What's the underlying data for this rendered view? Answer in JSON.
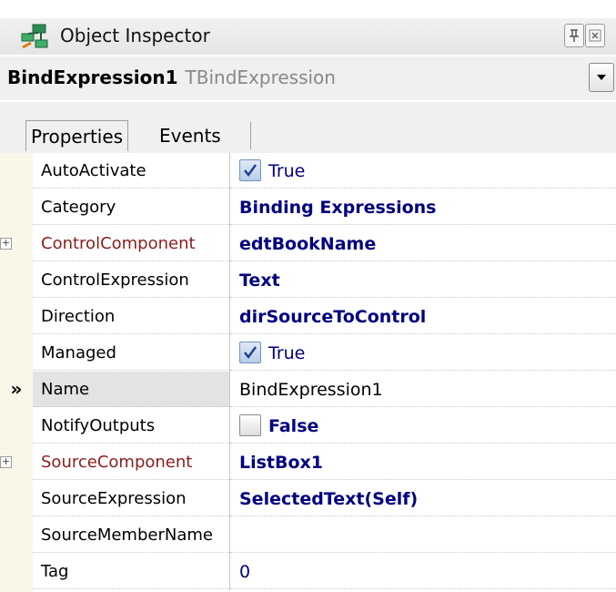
{
  "window": {
    "title": "Object Inspector",
    "pin_icon": "pin-icon",
    "close_icon": "close-icon"
  },
  "component_selector": {
    "name": "BindExpression1",
    "type": "TBindExpression"
  },
  "tabs": [
    {
      "label": "Properties",
      "active": true
    },
    {
      "label": "Events",
      "active": false
    }
  ],
  "properties": [
    {
      "name": "AutoActivate",
      "value": "True",
      "checkbox": true,
      "checked": true
    },
    {
      "name": "Category",
      "value": "Binding Expressions",
      "bold": true
    },
    {
      "name": "ControlComponent",
      "value": "edtBookName",
      "bold": true,
      "expandable": true,
      "red": true
    },
    {
      "name": "ControlExpression",
      "value": "Text",
      "bold": true
    },
    {
      "name": "Direction",
      "value": "dirSourceToControl",
      "bold": true
    },
    {
      "name": "Managed",
      "value": "True",
      "checkbox": true,
      "checked": true
    },
    {
      "name": "Name",
      "value": "BindExpression1",
      "selected": true,
      "indicator": "»"
    },
    {
      "name": "NotifyOutputs",
      "value": "False",
      "checkbox": true,
      "checked": false,
      "bold": true
    },
    {
      "name": "SourceComponent",
      "value": "ListBox1",
      "bold": true,
      "expandable": true,
      "red": true
    },
    {
      "name": "SourceExpression",
      "value": "SelectedText(Self)",
      "bold": true
    },
    {
      "name": "SourceMemberName",
      "value": ""
    },
    {
      "name": "Tag",
      "value": "0"
    }
  ],
  "colors": {
    "value_text": "#000080",
    "linked_property": "#8b1c1c",
    "gutter": "#fbf7e8"
  }
}
